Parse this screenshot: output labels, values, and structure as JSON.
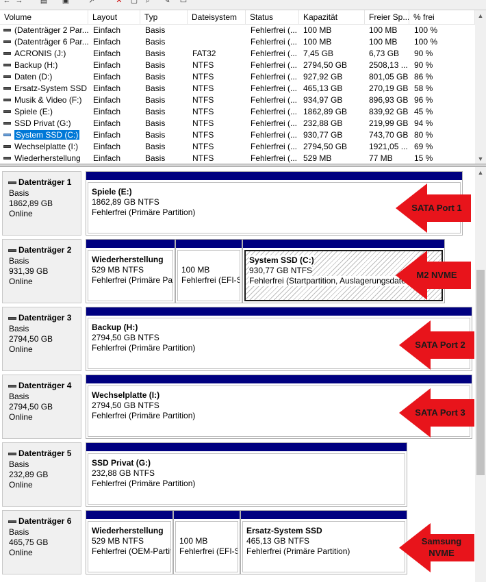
{
  "volume_list": {
    "columns": [
      "Volume",
      "Layout",
      "Typ",
      "Dateisystem",
      "Status",
      "Kapazität",
      "Freier Sp...",
      "% frei"
    ],
    "rows": [
      {
        "volume": "(Datenträger 2 Par...",
        "layout": "Einfach",
        "typ": "Basis",
        "fs": "",
        "status": "Fehlerfrei (...",
        "capacity": "100 MB",
        "free": "100 MB",
        "pct": "100 %"
      },
      {
        "volume": "(Datenträger 6 Par...",
        "layout": "Einfach",
        "typ": "Basis",
        "fs": "",
        "status": "Fehlerfrei (...",
        "capacity": "100 MB",
        "free": "100 MB",
        "pct": "100 %"
      },
      {
        "volume": "ACRONIS (J:)",
        "layout": "Einfach",
        "typ": "Basis",
        "fs": "FAT32",
        "status": "Fehlerfrei (...",
        "capacity": "7,45 GB",
        "free": "6,73 GB",
        "pct": "90 %"
      },
      {
        "volume": "Backup (H:)",
        "layout": "Einfach",
        "typ": "Basis",
        "fs": "NTFS",
        "status": "Fehlerfrei (...",
        "capacity": "2794,50 GB",
        "free": "2508,13 ...",
        "pct": "90 %"
      },
      {
        "volume": "Daten (D:)",
        "layout": "Einfach",
        "typ": "Basis",
        "fs": "NTFS",
        "status": "Fehlerfrei (...",
        "capacity": "927,92 GB",
        "free": "801,05 GB",
        "pct": "86 %"
      },
      {
        "volume": "Ersatz-System SSD",
        "layout": "Einfach",
        "typ": "Basis",
        "fs": "NTFS",
        "status": "Fehlerfrei (...",
        "capacity": "465,13 GB",
        "free": "270,19 GB",
        "pct": "58 %"
      },
      {
        "volume": "Musik & Video (F:)",
        "layout": "Einfach",
        "typ": "Basis",
        "fs": "NTFS",
        "status": "Fehlerfrei (...",
        "capacity": "934,97 GB",
        "free": "896,93 GB",
        "pct": "96 %"
      },
      {
        "volume": "Spiele (E:)",
        "layout": "Einfach",
        "typ": "Basis",
        "fs": "NTFS",
        "status": "Fehlerfrei (...",
        "capacity": "1862,89 GB",
        "free": "839,92 GB",
        "pct": "45 %"
      },
      {
        "volume": "SSD Privat (G:)",
        "layout": "Einfach",
        "typ": "Basis",
        "fs": "NTFS",
        "status": "Fehlerfrei (...",
        "capacity": "232,88 GB",
        "free": "219,99 GB",
        "pct": "94 %"
      },
      {
        "volume": "System SSD (C:)",
        "layout": "Einfach",
        "typ": "Basis",
        "fs": "NTFS",
        "status": "Fehlerfrei (...",
        "capacity": "930,77 GB",
        "free": "743,70 GB",
        "pct": "80 %",
        "selected": true
      },
      {
        "volume": "Wechselplatte (I:)",
        "layout": "Einfach",
        "typ": "Basis",
        "fs": "NTFS",
        "status": "Fehlerfrei (...",
        "capacity": "2794,50 GB",
        "free": "1921,05 ...",
        "pct": "69 %"
      },
      {
        "volume": "Wiederherstellung",
        "layout": "Einfach",
        "typ": "Basis",
        "fs": "NTFS",
        "status": "Fehlerfrei (...",
        "capacity": "529 MB",
        "free": "77 MB",
        "pct": "15 %"
      }
    ]
  },
  "disks": [
    {
      "name": "Datenträger 1",
      "type": "Basis",
      "size": "1862,89 GB",
      "state": "Online",
      "partitions": [
        {
          "title": "Spiele  (E:)",
          "size": "1862,89 GB NTFS",
          "status": "Fehlerfrei (Primäre Partition)"
        }
      ],
      "annotation": "SATA Port 1"
    },
    {
      "name": "Datenträger 2",
      "type": "Basis",
      "size": "931,39 GB",
      "state": "Online",
      "partitions": [
        {
          "title": "Wiederherstellung",
          "size": "529 MB NTFS",
          "status": "Fehlerfrei (Primäre Partition)"
        },
        {
          "title": "",
          "size": "100 MB",
          "status": "Fehlerfrei (EFI-Systempartition)"
        },
        {
          "title": "System SSD  (C:)",
          "size": "930,77 GB NTFS",
          "status": "Fehlerfrei (Startpartition, Auslagerungsdatei, Absturzabbild, Primäre Partition)",
          "selected": true
        }
      ],
      "annotation": "M2 NVME"
    },
    {
      "name": "Datenträger 3",
      "type": "Basis",
      "size": "2794,50 GB",
      "state": "Online",
      "partitions": [
        {
          "title": "Backup  (H:)",
          "size": "2794,50 GB NTFS",
          "status": "Fehlerfrei (Primäre Partition)"
        }
      ],
      "annotation": "SATA Port 2"
    },
    {
      "name": "Datenträger 4",
      "type": "Basis",
      "size": "2794,50 GB",
      "state": "Online",
      "partitions": [
        {
          "title": "Wechselplatte  (I:)",
          "size": "2794,50 GB NTFS",
          "status": "Fehlerfrei (Primäre Partition)"
        }
      ],
      "annotation": "SATA Port 3"
    },
    {
      "name": "Datenträger 5",
      "type": "Basis",
      "size": "232,89 GB",
      "state": "Online",
      "partitions": [
        {
          "title": "SSD Privat  (G:)",
          "size": "232,88 GB NTFS",
          "status": "Fehlerfrei (Primäre Partition)"
        }
      ],
      "annotation": ""
    },
    {
      "name": "Datenträger 6",
      "type": "Basis",
      "size": "465,75 GB",
      "state": "Online",
      "partitions": [
        {
          "title": "Wiederherstellung",
          "size": "529 MB NTFS",
          "status": "Fehlerfrei (OEM-Partition)"
        },
        {
          "title": "",
          "size": "100 MB",
          "status": "Fehlerfrei (EFI-Systempartition)"
        },
        {
          "title": "Ersatz-System SSD",
          "size": "465,13 GB NTFS",
          "status": "Fehlerfrei (Primäre Partition)"
        }
      ],
      "annotation": "Samsung NVME"
    }
  ],
  "colors": {
    "partition_bar": "#000080",
    "annotation_arrow": "#e8141b",
    "selection": "#0078d7"
  }
}
